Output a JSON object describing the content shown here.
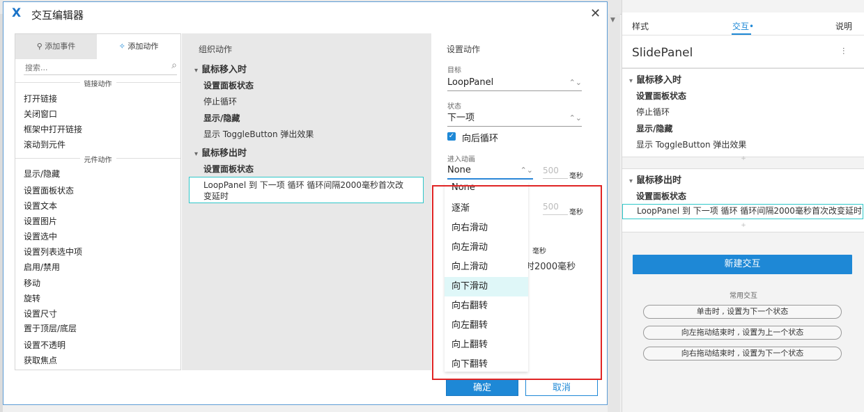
{
  "dialog": {
    "title": "交互编辑器",
    "close_icon": "close-icon",
    "left": {
      "tab_event": "添加事件",
      "tab_action": "添加动作",
      "search_placeholder": "搜索...",
      "section_link": "链接动作",
      "link_items": [
        "打开链接",
        "关闭窗口",
        "框架中打开链接",
        "滚动到元件"
      ],
      "section_widget": "元件动作",
      "widget_items": [
        "显示/隐藏",
        "设置面板状态",
        "设置文本",
        "设置图片",
        "设置选中",
        "设置列表选中项",
        "启用/禁用",
        "移动",
        "旋转",
        "设置尺寸",
        "置于顶层/底层",
        "设置不透明",
        "获取焦点"
      ]
    },
    "middle": {
      "title": "组织动作",
      "group1": "鼠标移入时",
      "g1_items": [
        "设置面板状态",
        "停止循环",
        "显示/隐藏",
        "显示 ToggleButton 弹出效果"
      ],
      "group2": "鼠标移出时",
      "g2_item": "设置面板状态",
      "selected_action": "LoopPanel 到 下一项 循环 循环间隔2000毫秒首次改变延时"
    },
    "right": {
      "title": "设置动作",
      "target_label": "目标",
      "target_value": "LoopPanel",
      "state_label": "状态",
      "state_value": "下一项",
      "loop_checkbox": "向后循环",
      "enter_anim_label": "进入动画",
      "enter_anim_value": "None",
      "duration_1": "500",
      "duration_2": "500",
      "unit": "毫秒",
      "ghost_unit": "毫秒",
      "ghost_text": "时2000毫秒"
    },
    "dropdown_options": [
      "None",
      "逐渐",
      "向右滑动",
      "向左滑动",
      "向上滑动",
      "向下滑动",
      "向右翻转",
      "向左翻转",
      "向上翻转",
      "向下翻转"
    ],
    "dropdown_highlighted": "向下滑动",
    "ok": "确定",
    "cancel": "取消"
  },
  "inspector": {
    "tabs": [
      "样式",
      "交互",
      "说明"
    ],
    "active_tab": "交互",
    "widget_name": "SlidePanel",
    "settings_icon": "sliders-icon",
    "event1": "鼠标移入时",
    "event1_items": [
      "设置面板状态",
      "停止循环",
      "显示/隐藏",
      "显示 ToggleButton 弹出效果"
    ],
    "event2": "鼠标移出时",
    "event2_item": "设置面板状态",
    "event2_selected": "LoopPanel 到 下一项 循环 循环间隔2000毫秒首次改变延时",
    "add_plus": "+",
    "new_interaction": "新建交互",
    "common_label": "常用交互",
    "common_buttons": [
      "单击时 , 设置为下一个状态",
      "向左拖动结束时 , 设置为上一个状态",
      "向右拖动结束时 , 设置为下一个状态"
    ]
  },
  "colors": {
    "accent": "#1e88d6",
    "selection": "#2ec7c9",
    "highlight_box": "#e02424"
  }
}
